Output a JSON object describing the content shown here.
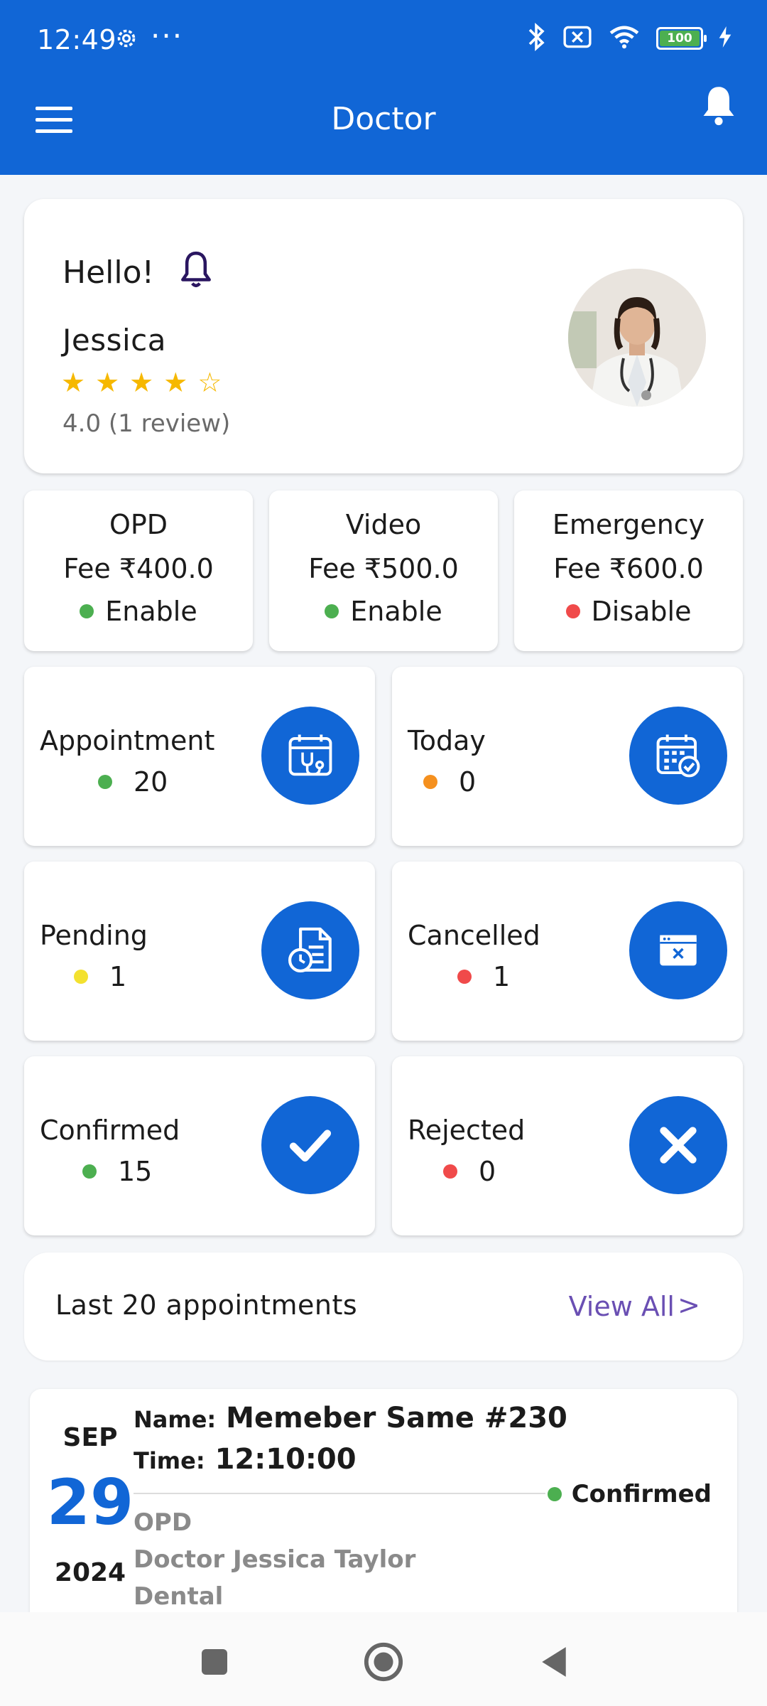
{
  "status_bar": {
    "time": "12:49",
    "battery": "100"
  },
  "appbar": {
    "title": "Doctor"
  },
  "profile": {
    "greeting": "Hello!",
    "name": "Jessica",
    "rating": 4,
    "rating_text": "4.0 (1 review)"
  },
  "fees": [
    {
      "title": "OPD",
      "fee": "Fee ₹400.0",
      "status": "Enable",
      "color": "#4caf50"
    },
    {
      "title": "Video",
      "fee": "Fee ₹500.0",
      "status": "Enable",
      "color": "#4caf50"
    },
    {
      "title": "Emergency",
      "fee": "Fee ₹600.0",
      "status": "Disable",
      "color": "#f04a4a"
    }
  ],
  "stats": [
    {
      "label": "Appointment",
      "value": "20",
      "dot": "#4caf50",
      "icon": "calendar-stethoscope-icon"
    },
    {
      "label": "Today",
      "value": "0",
      "dot": "#f5901e",
      "icon": "calendar-check-icon"
    },
    {
      "label": "Pending",
      "value": "1",
      "dot": "#f3e12f",
      "icon": "document-clock-icon"
    },
    {
      "label": "Cancelled",
      "value": "1",
      "dot": "#f04a4a",
      "icon": "window-close-icon"
    },
    {
      "label": "Confirmed",
      "value": "15",
      "dot": "#4caf50",
      "icon": "checkmark-icon"
    },
    {
      "label": "Rejected",
      "value": "0",
      "dot": "#f04a4a",
      "icon": "x-mark-icon"
    }
  ],
  "last_appointments": {
    "title": "Last 20 appointments",
    "view_all": "View All",
    "chevron": ">"
  },
  "appointment": {
    "month": "SEP",
    "day": "29",
    "year": "2024",
    "name_label": "Name:",
    "name": "Memeber Same #230",
    "time_label": "Time:",
    "time": "12:10:00",
    "status": "Confirmed",
    "status_color": "#4caf50",
    "type": "OPD",
    "doctor": "Doctor Jessica Taylor",
    "department": "Dental"
  },
  "colors": {
    "primary": "#1166d6",
    "accent_link": "#6a4fb3",
    "star": "#f6b800"
  }
}
